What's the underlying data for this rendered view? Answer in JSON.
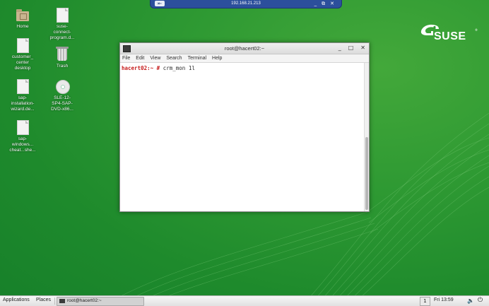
{
  "remote_bar": {
    "title": "192.168.21.213",
    "pin_icon": "pin-icon",
    "controls": [
      "_",
      "⧉",
      "✕"
    ]
  },
  "desktop": {
    "icons": [
      {
        "label": "Home",
        "icon": "home-folder-icon"
      },
      {
        "label": "suse-\nconnect-\nprogram.d...",
        "icon": "document-icon"
      },
      {
        "label": "customer_\ncenter\ndesktop",
        "icon": "document-icon"
      },
      {
        "label": "Trash",
        "icon": "trash-icon"
      },
      {
        "label": "sap-\ninstallation-\nwizard.de...",
        "icon": "document-icon"
      },
      {
        "label": "SLE-12-\nSP4-SAP-\nDVD-x86...",
        "icon": "disc-icon"
      },
      {
        "label": "sap-\nwindows...\ncheat...she...",
        "icon": "document-icon"
      }
    ],
    "logo_text": "SUSE",
    "logo_tm": "®"
  },
  "terminal": {
    "title": "root@hacert02:~",
    "controls": [
      "_",
      "□",
      "✕"
    ],
    "menu": [
      "File",
      "Edit",
      "View",
      "Search",
      "Terminal",
      "Help"
    ],
    "prompt_host": "hacert02:~",
    "prompt_symbol": " # ",
    "command": "crm_mon 1l"
  },
  "taskbar": {
    "applications": "Applications",
    "places": "Places",
    "task_label": "root@hacert02:~",
    "workspace": "1",
    "clock": "Fri 13:59",
    "volume_icon": "volume-icon",
    "power_icon": "power-icon"
  },
  "colors": {
    "desktop_green": "#2f9a33",
    "prompt_red": "#c61a1a",
    "rdp_blue": "#2c4f9c"
  }
}
